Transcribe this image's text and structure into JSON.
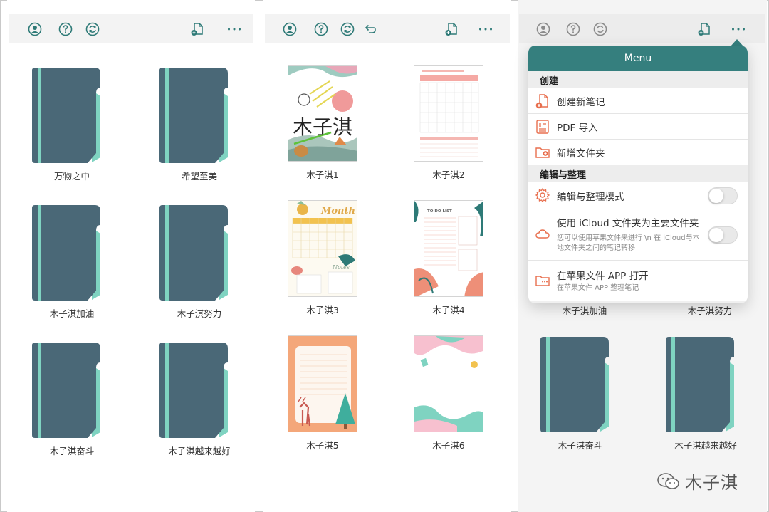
{
  "colors": {
    "folder": "#4a6877",
    "folder_tab": "#7fd3c1",
    "menu_header": "#357f7e",
    "icon_accent": "#e86f4e",
    "toolbar_icon": "#2e7a77"
  },
  "panel1": {
    "folders": [
      {
        "label": "万物之中"
      },
      {
        "label": "希望至美"
      },
      {
        "label": "木子淇加油"
      },
      {
        "label": "木子淇努力"
      },
      {
        "label": "木子淇奋斗"
      },
      {
        "label": "木子淇越来越好"
      }
    ]
  },
  "panel2": {
    "notebooks": [
      {
        "label": "木子淇1"
      },
      {
        "label": "木子淇2"
      },
      {
        "label": "木子淇3"
      },
      {
        "label": "木子淇4"
      },
      {
        "label": "木子淇5"
      },
      {
        "label": "木子淇6"
      }
    ]
  },
  "panel3": {
    "folders": [
      {
        "label": "木子淇加油"
      },
      {
        "label": "木子淇努力"
      },
      {
        "label": "木子淇奋斗"
      },
      {
        "label": "木子淇越来越好"
      }
    ],
    "menu": {
      "title": "Menu",
      "section_create": "创建",
      "new_note": "创建新笔记",
      "pdf_import": "PDF 导入",
      "new_folder": "新增文件夹",
      "section_edit": "编辑与整理",
      "edit_mode": "编辑与整理模式",
      "icloud_title": "使用 iCloud 文件夹为主要文件夹",
      "icloud_sub": "您可以使用苹果文件来进行 \\n 在 iCloud与本地文件夹之间的笔记转移",
      "open_files_title": "在苹果文件 APP 打开",
      "open_files_sub": "在苹果文件 APP 整理笔记"
    }
  },
  "covers": {
    "nb1_text": "木子淇",
    "nb3_title": "Month",
    "nb3_notes": "Notes",
    "nb4_title": "TO DO LIST"
  },
  "watermark": "木子淇"
}
